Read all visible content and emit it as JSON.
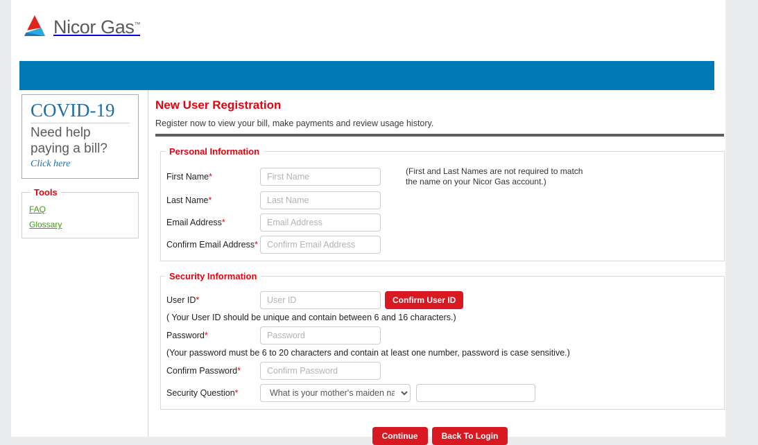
{
  "brand": {
    "name": "Nicor Gas",
    "trademark": "™",
    "logo_icon": "nicor-triangle-logo",
    "colors": {
      "red": "#e8000d",
      "button_red": "#d81921",
      "nav_blue": "#0079b6",
      "link_blue": "#1a6fa8",
      "link_green": "#3f9c0c",
      "logo_red": "#e1231f",
      "logo_cyan": "#29abe2",
      "logo_blue": "#1c75bc",
      "logo_green": "#8cc63f"
    }
  },
  "sidebar": {
    "covid": {
      "title": "COVID-19",
      "text": "Need help paying a bill?",
      "link_label": "Click here"
    },
    "tools": {
      "legend": "Tools",
      "links": [
        {
          "label": "FAQ"
        },
        {
          "label": "Glossary"
        }
      ]
    }
  },
  "main": {
    "title": "New User Registration",
    "subtitle": "Register now to view your bill, make payments and review usage history.",
    "personal": {
      "legend": "Personal Information",
      "note": "(First and Last Names are not required to match the name on your Nicor Gas account.)",
      "fields": [
        {
          "label": "First Name",
          "required": "*",
          "value": "",
          "placeholder": "First Name"
        },
        {
          "label": "Last Name",
          "required": "*",
          "value": "",
          "placeholder": "Last Name"
        },
        {
          "label": "Email Address",
          "required": "*",
          "value": "",
          "placeholder": "Email Address"
        },
        {
          "label": "Confirm Email Address",
          "required": "*",
          "value": "",
          "placeholder": "Confirm Email Address"
        }
      ]
    },
    "security": {
      "legend": "Security Information",
      "userid": {
        "label": "User ID",
        "required": "*",
        "value": "",
        "placeholder": "User ID",
        "button_label": "Confirm User ID",
        "hint": "( Your User ID should be unique and contain between 6 and 16 characters.)"
      },
      "password": {
        "label": "Password",
        "required": "*",
        "value": "",
        "placeholder": "Password",
        "hint": "(Your password must be 6 to 20 characters and contain at least one number, password is case sensitive.)"
      },
      "confirm_password": {
        "label": "Confirm Password",
        "required": "*",
        "value": "",
        "placeholder": "Confirm Password"
      },
      "security_question": {
        "label": "Security Question",
        "required": "*",
        "selected": "What is your mother's maiden name?",
        "answer_value": "",
        "answer_placeholder": ""
      }
    },
    "actions": {
      "continue_label": "Continue",
      "back_label": "Back To Login"
    }
  }
}
